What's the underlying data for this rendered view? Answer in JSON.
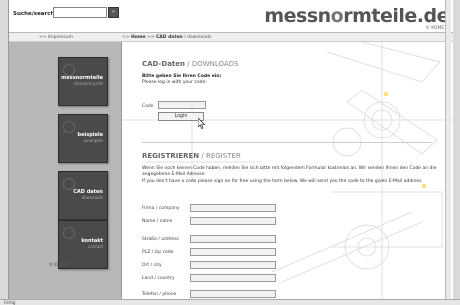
{
  "header": {
    "search_label": "Suche/search",
    "search_go": "»",
    "brand_prefix": "messn",
    "brand_o": "o",
    "brand_suffix": "rmteile.de",
    "brand_sub": "© KOMET"
  },
  "navbar": {
    "left_link": ">> Impressum",
    "crumb_prefix": ">> ",
    "crumb_home": "Home",
    "crumb_sep1": " >> ",
    "crumb_cad": "CAD daten",
    "crumb_sep2": " / ",
    "crumb_downloads": "downloads"
  },
  "sidebar": {
    "tiles": [
      {
        "title": "messnormteile",
        "sub": "standard parts"
      },
      {
        "title": "beispiele",
        "sub": "examples"
      },
      {
        "title": "CAD daten",
        "sub": "downloads"
      },
      {
        "title": "kontakt",
        "sub": "contact"
      }
    ],
    "foot": "© KOMET"
  },
  "login": {
    "heading_main": "CAD-Daten",
    "heading_thin": " / DOWNLOADS",
    "intro_de": "Bitte geben Sie Ihren Code ein:",
    "intro_en": "Please log in with your code:",
    "code_label": "Code",
    "login_button": "Login"
  },
  "register": {
    "heading_main": "REGISTRIEREN",
    "heading_thin": " / REGISTER",
    "text_de": "Wenn Sie noch keinen Code haben, melden Sie sich bitte mit folgendem Formular kostenlos an. Wir senden Ihnen den Code an die angegebene E-Mail Adresse.",
    "text_en": "If you don't have a code please sign on for free using the form below. We will send you the code to the given E-Mail address.",
    "fields": [
      "Firma / company",
      "Name / name",
      "Straße / address",
      "PLZ / zip code",
      "Ort / city",
      "Land / country",
      "Telefon / phone"
    ]
  },
  "status": {
    "text": "Fertig"
  }
}
